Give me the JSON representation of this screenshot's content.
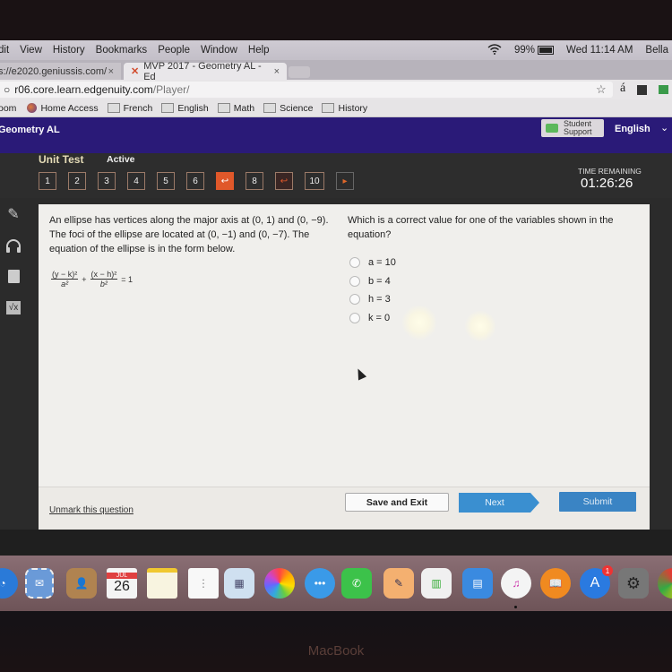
{
  "menubar": {
    "items": [
      "dit",
      "View",
      "History",
      "Bookmarks",
      "People",
      "Window",
      "Help"
    ],
    "battery": "99%",
    "clock": "Wed 11:14 AM",
    "user": "Bella"
  },
  "tabs": [
    {
      "label": "s://e2020.geniussis.com/",
      "close": "×"
    },
    {
      "label": "MVP 2017 - Geometry AL - Ed",
      "close": "×"
    }
  ],
  "address": {
    "host": "r06.core.learn.edgenuity.com",
    "path": "/Player/"
  },
  "bookmarks": [
    "oom",
    "Home Access",
    "French",
    "English",
    "Math",
    "Science",
    "History"
  ],
  "header": {
    "course": "Geometry AL",
    "support_line1": "Student",
    "support_line2": "Support",
    "language": "English"
  },
  "test": {
    "title": "Unit Test",
    "status": "Active",
    "questions": [
      {
        "label": "1",
        "state": "normal"
      },
      {
        "label": "2",
        "state": "normal"
      },
      {
        "label": "3",
        "state": "normal"
      },
      {
        "label": "4",
        "state": "normal"
      },
      {
        "label": "5",
        "state": "normal"
      },
      {
        "label": "6",
        "state": "normal"
      },
      {
        "label": "↩",
        "state": "current-marked"
      },
      {
        "label": "8",
        "state": "normal"
      },
      {
        "label": "↩",
        "state": "marked"
      },
      {
        "label": "10",
        "state": "normal"
      },
      {
        "label": "▸",
        "state": "next-arrow"
      }
    ],
    "time_label": "TIME REMAINING",
    "time": "01:26:26"
  },
  "tools": [
    "pencil-icon",
    "headphones-icon",
    "calculator-icon",
    "square-root-icon"
  ],
  "question": {
    "text": "An ellipse has vertices along the major axis at (0, 1) and (0, −9). The foci of the ellipse are located at (0, −1) and (0, −7). The equation of the ellipse is in the form below.",
    "eq_num1": "(y − k)²",
    "eq_den1": "a²",
    "eq_plus": "+",
    "eq_num2": "(x − h)²",
    "eq_den2": "b²",
    "eq_rhs": "= 1",
    "prompt": "Which is a correct value for one of the variables shown in the equation?",
    "options": [
      "a = 10",
      "b = 4",
      "h = 3",
      "k = 0"
    ]
  },
  "footer": {
    "unmark": "Unmark this question",
    "save": "Save and Exit",
    "next": "Next",
    "submit": "Submit"
  },
  "dock": {
    "calendar_month": "JUL",
    "calendar_day": "26",
    "appstore_badge": "1"
  },
  "bezel_label": "MacBook"
}
